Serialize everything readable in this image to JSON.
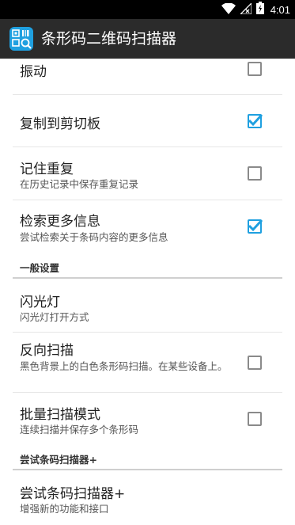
{
  "status_bar": {
    "time": "4:01",
    "icons": [
      "wifi-icon",
      "signal-off-icon",
      "battery-charging-icon"
    ]
  },
  "toolbar": {
    "title": "条形码二维码扫描器",
    "app_icon": "barcode-qr-scanner-icon"
  },
  "settings": {
    "vibrate": {
      "title": "振动",
      "checked": false
    },
    "copy_clipboard": {
      "title": "复制到剪切板",
      "checked": true
    },
    "remember_duplicates": {
      "title": "记住重复",
      "summary": "在历史记录中保存重复记录",
      "checked": false
    },
    "retrieve_more": {
      "title": "检索更多信息",
      "summary": "尝试检索关于条码内容的更多信息",
      "checked": true
    },
    "general_header": "一般设置",
    "flashlight": {
      "title": "闪光灯",
      "summary": "闪光灯打开方式"
    },
    "reverse_scan": {
      "title": "反向扫描",
      "summary": "黑色背景上的白色条形码扫描。在某些设备上。",
      "checked": false
    },
    "batch_scan": {
      "title": "批量扫描模式",
      "summary": "连续扫描并保存多个条形码",
      "checked": false
    },
    "plus_header": "尝试条码扫描器+",
    "try_plus": {
      "title": "尝试条码扫描器+",
      "summary": "增强新的功能和接口"
    }
  },
  "colors": {
    "accent": "#1fa0e0",
    "toolbar": "#2b2b2b",
    "status_bar": "#000000"
  }
}
